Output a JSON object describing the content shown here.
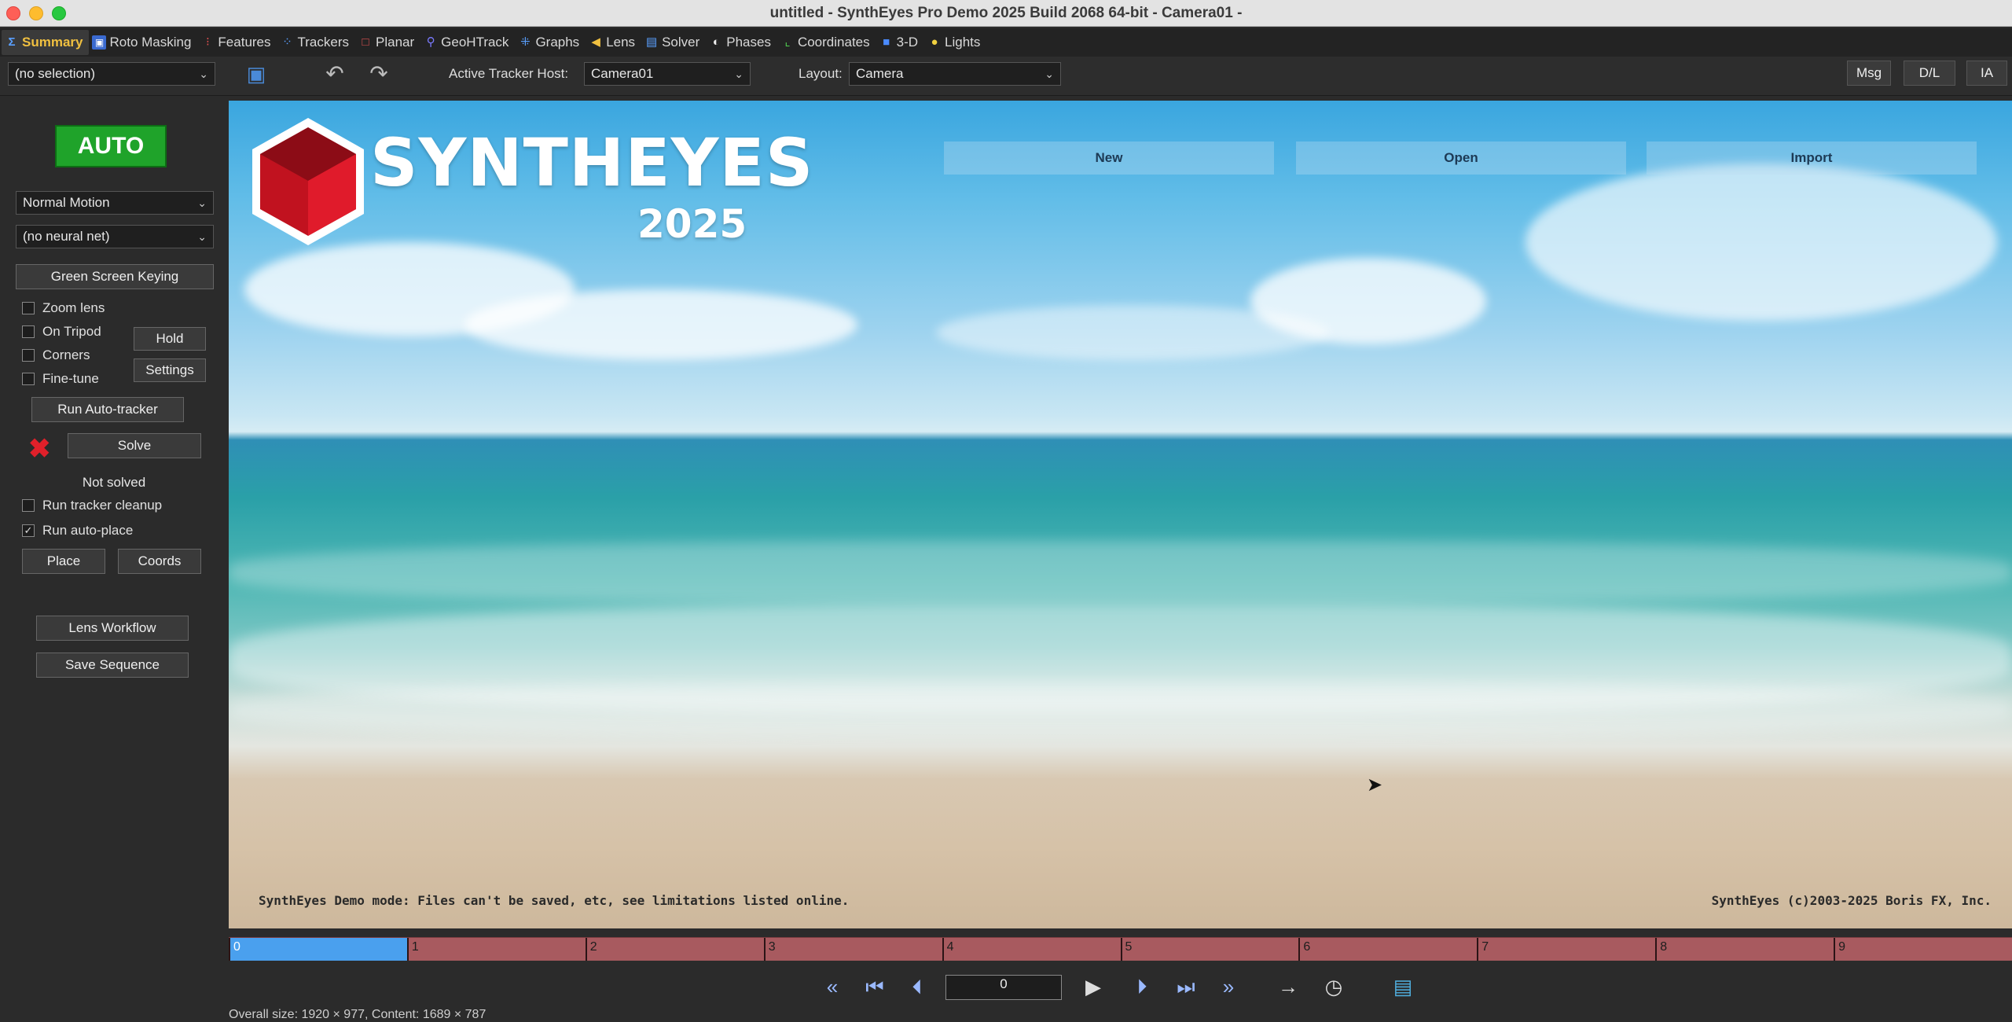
{
  "window": {
    "title": "untitled - SynthEyes Pro Demo 2025 Build 2068 64-bit - Camera01 -"
  },
  "tabs": [
    {
      "label": "Summary",
      "icon": "sigma-icon"
    },
    {
      "label": "Roto Masking",
      "icon": "roto-icon"
    },
    {
      "label": "Features",
      "icon": "features-icon"
    },
    {
      "label": "Trackers",
      "icon": "trackers-icon"
    },
    {
      "label": "Planar",
      "icon": "planar-icon"
    },
    {
      "label": "GeoHTrack",
      "icon": "geohtrack-icon"
    },
    {
      "label": "Graphs",
      "icon": "graphs-icon"
    },
    {
      "label": "Lens",
      "icon": "lens-icon"
    },
    {
      "label": "Solver",
      "icon": "solver-icon"
    },
    {
      "label": "Phases",
      "icon": "phases-icon"
    },
    {
      "label": "Coordinates",
      "icon": "coordinates-icon"
    },
    {
      "label": "3-D",
      "icon": "cube-icon"
    },
    {
      "label": "Lights",
      "icon": "bulb-icon"
    }
  ],
  "toolbar": {
    "selection": "(no selection)",
    "active_tracker_host_label": "Active Tracker Host:",
    "active_tracker_host": "Camera01",
    "layout_label": "Layout:",
    "layout": "Camera",
    "msg": "Msg",
    "dl": "D/L",
    "ia": "IA"
  },
  "left": {
    "auto": "AUTO",
    "motion": "Normal Motion",
    "neural": "(no neural net)",
    "green_screen": "Green Screen Keying",
    "zoom_lens": "Zoom lens",
    "on_tripod": "On Tripod",
    "corners": "Corners",
    "fine_tune": "Fine-tune",
    "hold": "Hold",
    "settings": "Settings",
    "run_autotracker": "Run Auto-tracker",
    "solve": "Solve",
    "status": "Not solved",
    "run_cleanup": "Run tracker cleanup",
    "run_autoplace": "Run auto-place",
    "place": "Place",
    "coords": "Coords",
    "lens_workflow": "Lens Workflow",
    "save_sequence": "Save Sequence",
    "checks": {
      "zoom_lens": false,
      "on_tripod": false,
      "corners": false,
      "fine_tune": false,
      "run_cleanup": false,
      "run_autoplace": true
    }
  },
  "viewport": {
    "new": "New",
    "open": "Open",
    "import": "Import",
    "logo_name": "SYNTHEYES",
    "logo_year": "2025",
    "demo_note": "SynthEyes Demo mode:  Files can't be saved, etc, see limitations listed online.",
    "copyright": "SynthEyes (c)2003-2025 Boris FX, Inc."
  },
  "timeline": {
    "ticks": [
      "0",
      "1",
      "2",
      "3",
      "4",
      "5",
      "6",
      "7",
      "8",
      "9"
    ],
    "current_frame": 0,
    "played_until_frame": 1
  },
  "transport": {
    "frame_value": "0"
  },
  "footer": {
    "size_info": "Overall size: 1920 × 977, Content: 1689 × 787"
  }
}
